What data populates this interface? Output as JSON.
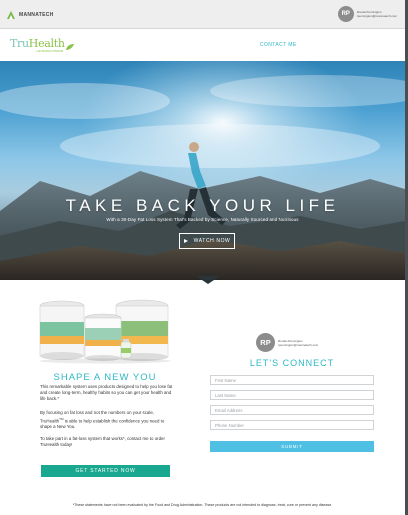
{
  "topbar": {
    "brand": "MANNATECH",
    "user": {
      "initials": "RP",
      "name": "Ronda Pennington",
      "email": "rpennington@mannatech.com"
    }
  },
  "nav": {
    "logo_word_a": "Tru",
    "logo_word_b": "Health",
    "logo_sub": "a MANNATECH BRAND",
    "contact_label": "CONTACT ME"
  },
  "hero": {
    "title": "TAKE BACK YOUR LIFE",
    "subtitle": "With a 30-Day Fat Loss System That's Backed by Science, Naturally Sourced and Nutritious",
    "watch_label": "WATCH NOW"
  },
  "left": {
    "title": "SHAPE A NEW YOU",
    "p1": "This remarkable system uses products designed to help you lose fat and create long-term, healthy habits so you can get your health and life back.*",
    "p2_a": "By focusing on fat loss and not the numbers on your scale, TruHealth",
    "p2_tm": "TM",
    "p2_b": " is able to help establish the confidence you need to shape a New You.",
    "p3": "To take part in a fat-loss system that works*, contact me to order TruHealth today!",
    "cta_label": "GET STARTED NOW"
  },
  "right": {
    "user": {
      "initials": "RP",
      "name": "Ronda Pennington",
      "email": "rpennington@mannatech.com"
    },
    "title": "LET'S CONNECT",
    "fields": {
      "first_name": "First Name",
      "last_name": "Last Name",
      "email": "Email Address",
      "phone": "Phone Number"
    },
    "submit_label": "SUBMIT"
  },
  "footer": {
    "disclaimer": "*These statements have not been evaluated by the Food and Drug Administration. These products are not intended to diagnose, treat, cure or prevent any disease."
  },
  "colors": {
    "accent_teal": "#2cb9c5",
    "cta_green": "#19a88f",
    "submit_blue": "#4fc0e4",
    "logo_green": "#8bc34a"
  },
  "icons": [
    "mannatech-logo-icon",
    "leaf-icon",
    "play-icon"
  ]
}
